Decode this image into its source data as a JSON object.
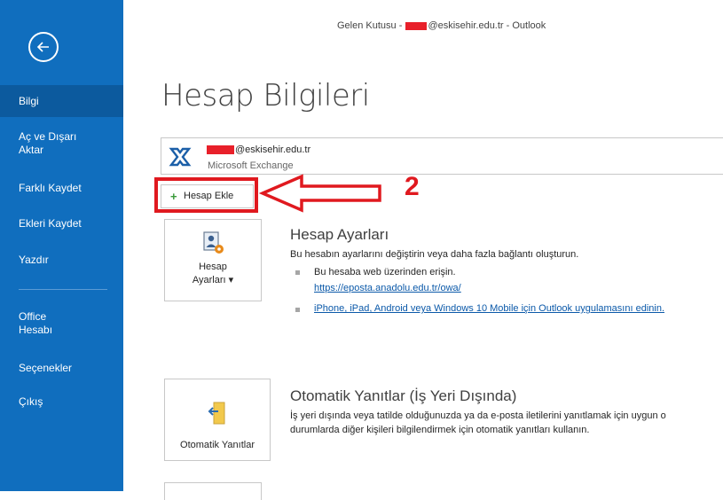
{
  "window": {
    "title_prefix": "Gelen Kutusu - ",
    "title_suffix": "@eskisehir.edu.tr  -  Outlook"
  },
  "sidebar": {
    "items": [
      {
        "label": "Bilgi"
      },
      {
        "label": "Aç ve Dışarı"
      },
      {
        "label": "Aktar"
      },
      {
        "label": "Farklı Kaydet"
      },
      {
        "label": "Ekleri Kaydet"
      },
      {
        "label": "Yazdır"
      },
      {
        "label": "Office"
      },
      {
        "label": "Hesabı"
      },
      {
        "label": "Seçenekler"
      },
      {
        "label": "Çıkış"
      }
    ]
  },
  "main": {
    "title": "Hesap Bilgileri",
    "account": {
      "email_suffix": "@eskisehir.edu.tr",
      "type": "Microsoft Exchange"
    },
    "add_account": {
      "label": "Hesap Ekle"
    },
    "annotation": {
      "step": "2"
    },
    "account_settings": {
      "tile_line1": "Hesap",
      "tile_line2": "Ayarları ▾",
      "title": "Hesap Ayarları",
      "description": "Bu hesabın ayarlarını değiştirin veya daha fazla bağlantı oluşturun.",
      "bullet1": "Bu hesaba web üzerinden erişin.",
      "link1": "https://eposta.anadolu.edu.tr/owa/",
      "link2": "iPhone, iPad, Android veya Windows 10 Mobile için Outlook uygulamasını edinin."
    },
    "auto_reply": {
      "tile_label": "Otomatik Yanıtlar",
      "title": "Otomatik Yanıtlar (İş Yeri Dışında)",
      "line1": "İş yeri dışında veya tatilde olduğunuzda ya da e-posta iletilerini yanıtlamak için uygun o",
      "line2": "durumlarda diğer kişileri bilgilendirmek için otomatik yanıtları kullanın."
    }
  },
  "colors": {
    "sidebar": "#106ebe",
    "sidebar_active": "#0c5a9e",
    "annotation_red": "#e0191f",
    "link": "#0b59a9"
  }
}
